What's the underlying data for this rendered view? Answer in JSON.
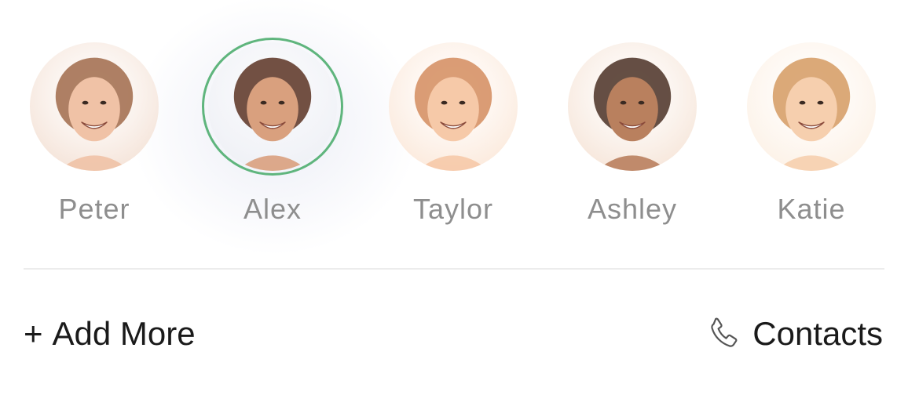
{
  "colors": {
    "selected_ring": "#5fb57d",
    "name_text": "#8e8e8e",
    "footer_text": "#1a1a1a",
    "divider": "#ececec"
  },
  "contacts": [
    {
      "name": "Peter",
      "selected": false,
      "palette": {
        "bg": "#f3dfd2",
        "hair": "#a06a4a",
        "skin": "#f0c2a6"
      }
    },
    {
      "name": "Alex",
      "selected": true,
      "palette": {
        "bg": "#eceef4",
        "hair": "#5a3322",
        "skin": "#d9a07e"
      }
    },
    {
      "name": "Taylor",
      "selected": false,
      "palette": {
        "bg": "#fbe6d6",
        "hair": "#d48c5e",
        "skin": "#f6c9a8"
      }
    },
    {
      "name": "Ashley",
      "selected": false,
      "palette": {
        "bg": "#f5e2d4",
        "hair": "#4a3024",
        "skin": "#b9805e"
      }
    },
    {
      "name": "Katie",
      "selected": false,
      "palette": {
        "bg": "#fcefe2",
        "hair": "#d59a62",
        "skin": "#f6cfae"
      }
    }
  ],
  "footer": {
    "add_more_plus": "+",
    "add_more_label": "Add More",
    "contacts_label": "Contacts",
    "contacts_icon": "phone-icon"
  }
}
